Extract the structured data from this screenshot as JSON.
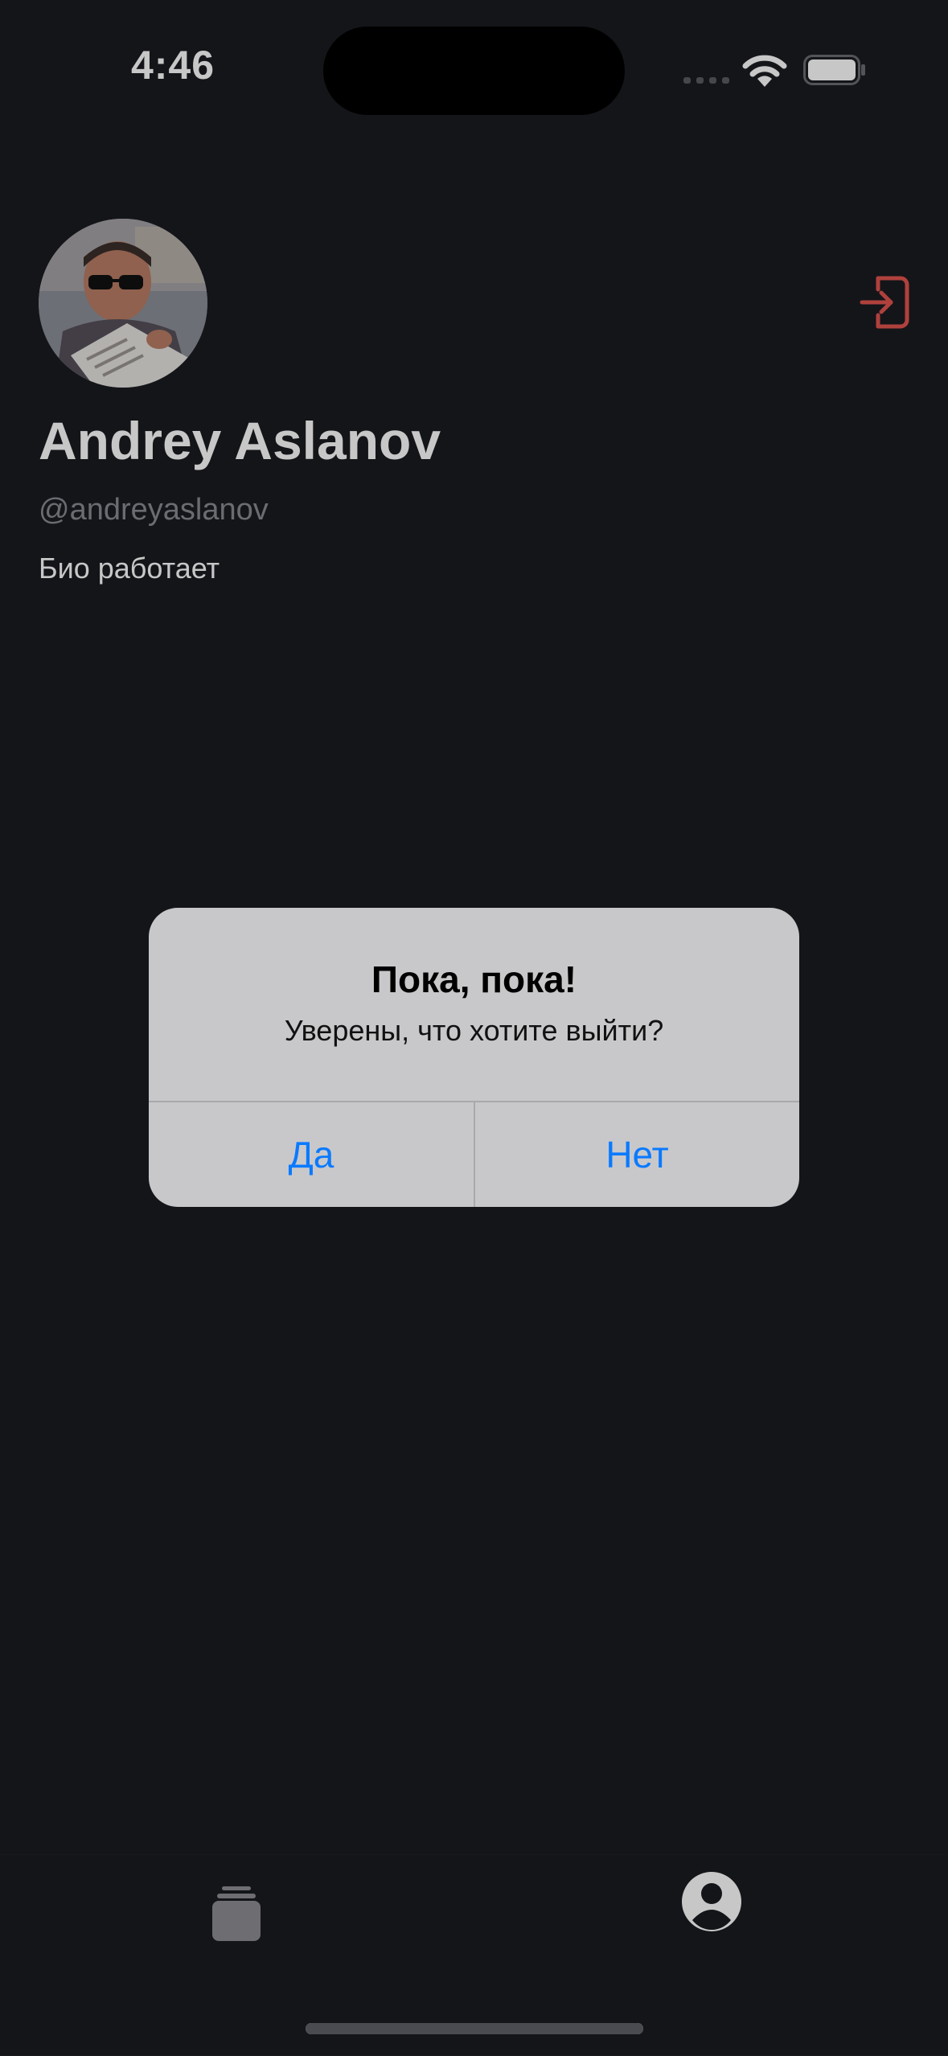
{
  "status_bar": {
    "time": "4:46"
  },
  "profile": {
    "name": "Andrey Aslanov",
    "handle": "@andreyaslanov",
    "bio": "Био работает",
    "avatar_icon": "profile-photo",
    "logout_icon": "logout-icon"
  },
  "alert": {
    "title": "Пока, пока!",
    "message": "Уверены, что хотите выйти?",
    "yes_label": "Да",
    "no_label": "Нет"
  },
  "tabbar": {
    "items": [
      {
        "icon": "stack-icon",
        "selected": false
      },
      {
        "icon": "person-circle-icon",
        "selected": true
      }
    ]
  },
  "colors": {
    "background": "#1a1b20",
    "accent_red": "#e0544f",
    "alert_button_blue": "#0a7aff",
    "alert_background": "#c8c8ca"
  }
}
